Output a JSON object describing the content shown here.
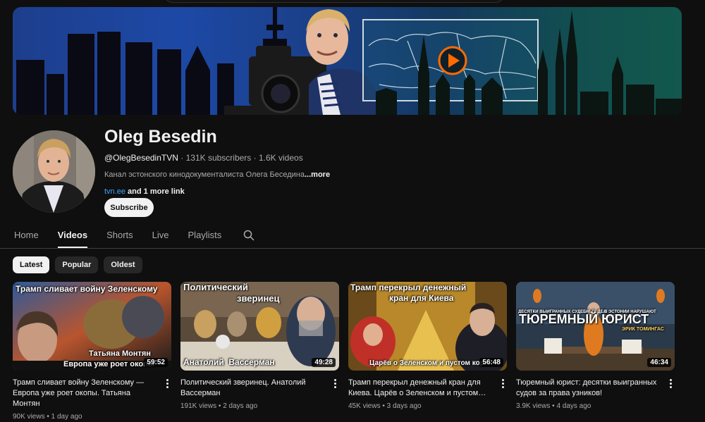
{
  "channel": {
    "name": "Oleg Besedin",
    "handle": "@OlegBesedinTVN",
    "subscribers": "131K subscribers",
    "video_count": "1.6K videos",
    "separator": "·",
    "description": "Канал эстонского кинодокументалиста Олега Беседина",
    "more_label": "...more",
    "link": "tvn.ee",
    "more_links": "and 1 more link",
    "subscribe_label": "Subscribe"
  },
  "tabs": [
    {
      "label": "Home"
    },
    {
      "label": "Videos",
      "active": true
    },
    {
      "label": "Shorts"
    },
    {
      "label": "Live"
    },
    {
      "label": "Playlists"
    }
  ],
  "chips": [
    {
      "label": "Latest",
      "active": true
    },
    {
      "label": "Popular"
    },
    {
      "label": "Oldest"
    }
  ],
  "videos": [
    {
      "title": "Трамп сливает войну Зеленскому — Европа уже роет окопы. Татьяна Монтян",
      "views": "90K views",
      "age": "1 day ago",
      "duration": "59:52",
      "thumb_text": [
        "Трамп сливает войну Зеленскому",
        "Татьяна Монтян",
        "Европа уже роет окопы"
      ]
    },
    {
      "title": "Политический зверинец. Анатолий Вассерман",
      "views": "191K views",
      "age": "2 days ago",
      "duration": "49:28",
      "thumb_text": [
        "Политический",
        "зверинец",
        "Анатолий  Вассерман"
      ]
    },
    {
      "title": "Трамп перекрыл денежный кран для Киева. Царёв о Зеленском и пустом…",
      "views": "45K views",
      "age": "3 days ago",
      "duration": "56:48",
      "thumb_text": [
        "Трамп перекрыл денежный",
        "кран для Киева",
        "Царёв о Зеленском и пустом кор"
      ]
    },
    {
      "title": "Тюремный юрист: десятки выигранных судов за права узников!",
      "views": "3.9K views",
      "age": "4 days ago",
      "duration": "46:34",
      "thumb_text": [
        "ТЮРЕМНЫЙ ЮРИСТ",
        "ДЕСЯТКИ ВЫИГРАННЫХ СУДЕБНЫХ ДЕЛ",
        "В ЭСТОНИИ НАРУШАЮТ КОНСТИТУЦИЮ",
        "ЭРИК ТОМИНГАС"
      ]
    }
  ],
  "meta_separator": "•",
  "icons": {
    "tab_search": "search-icon",
    "video_menu": "more-vert-icon",
    "banner_play": "play-icon"
  },
  "colors": {
    "background": "#0f0f0f",
    "link": "#3ea6ff",
    "play_orange": "#ff6a00"
  }
}
